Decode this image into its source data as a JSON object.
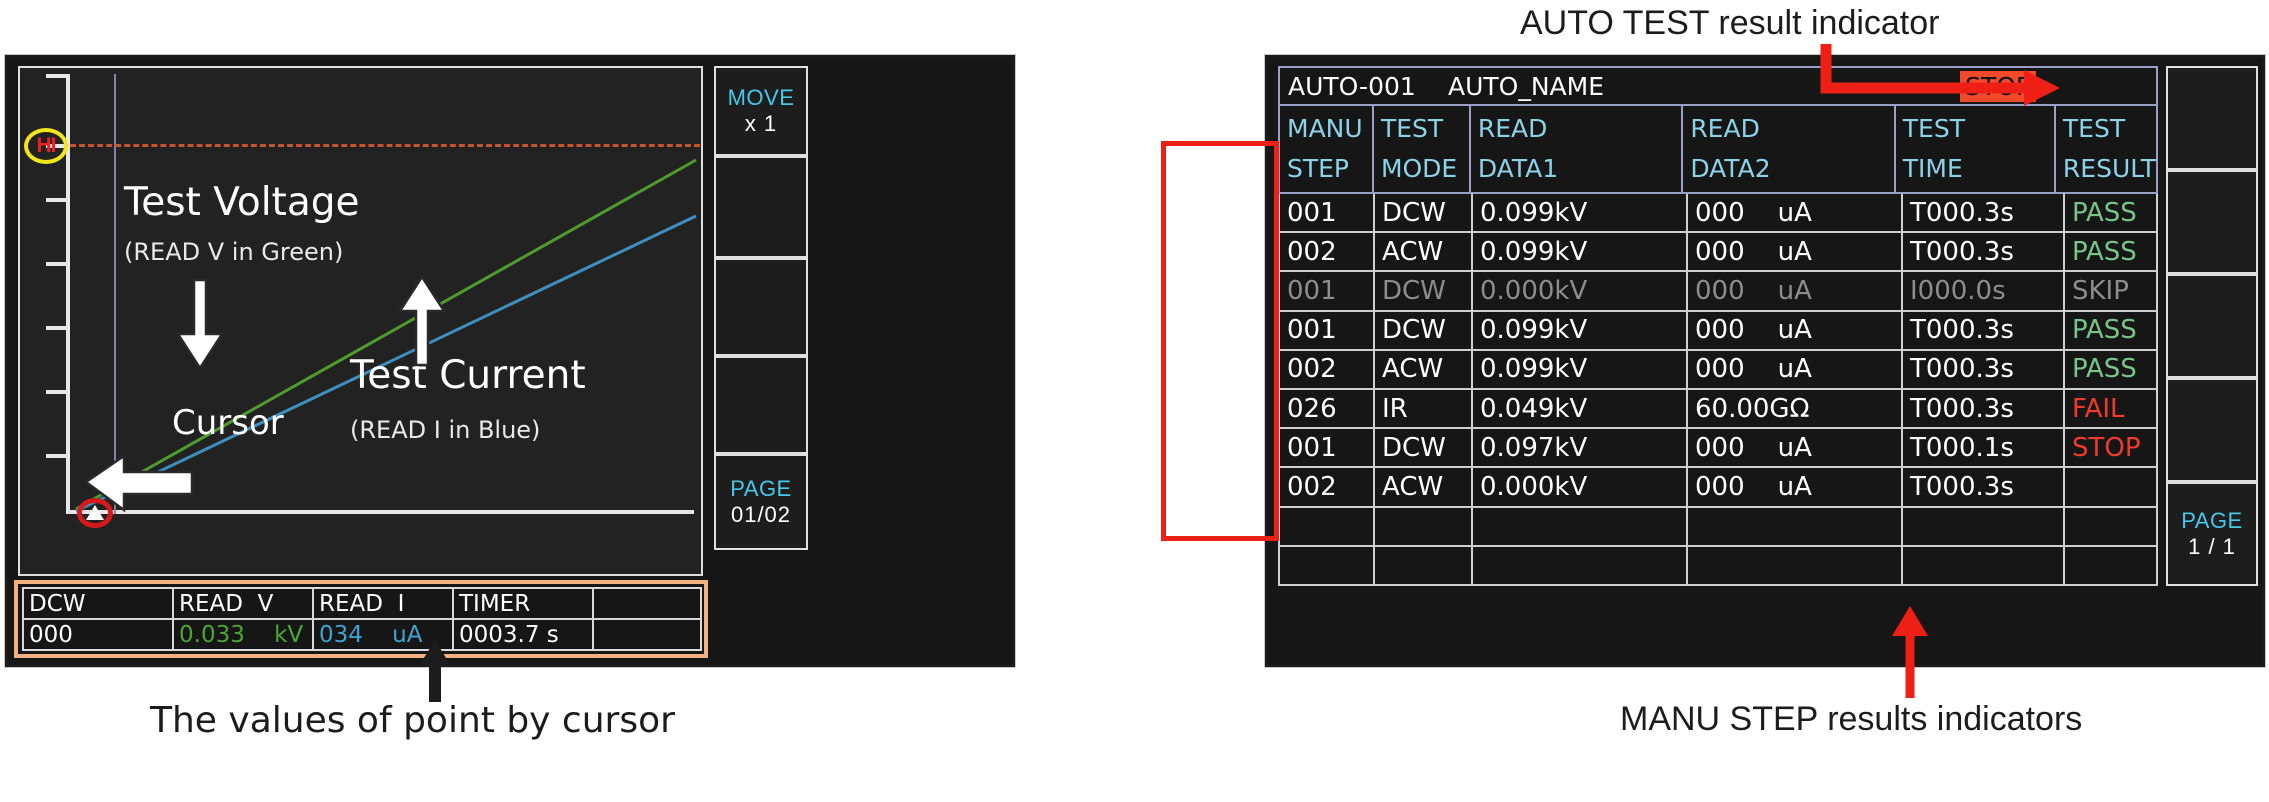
{
  "left_screen": {
    "plot": {
      "hi_badge": "HI",
      "label_voltage": "Test Voltage",
      "label_voltage_sub": "(READ V in Green)",
      "label_current": "Test Current",
      "label_current_sub": "(READ I in Blue)",
      "label_cursor": "Cursor",
      "voltage_color": "#4f9b2e",
      "current_color": "#3e8fc0",
      "cursor_line_color": "#8a7fa8",
      "hi_line_color": "#c4552f"
    },
    "readout": {
      "headers": [
        "DCW",
        "READ  V",
        "READ  I",
        "TIMER",
        ""
      ],
      "values": [
        "000",
        "0.033    kV",
        "034    uA",
        "0003.7 s",
        ""
      ]
    },
    "softkeys": [
      {
        "title": "MOVE",
        "sub": "x   1"
      },
      {
        "title": "",
        "sub": ""
      },
      {
        "title": "",
        "sub": ""
      },
      {
        "title": "",
        "sub": ""
      },
      {
        "title": "PAGE",
        "sub": "01/02"
      }
    ],
    "caption": "The values of point by cursor"
  },
  "right_screen": {
    "title_bar": {
      "auto_id": "AUTO-001",
      "auto_name": "AUTO_NAME",
      "status": "STOP",
      "status_bg": "#f04a2a"
    },
    "headers": [
      "MANU\nSTEP",
      "TEST\nMODE",
      "READ\nDATA1",
      "READ\nDATA2",
      "TEST\nTIME",
      "TEST\nRESULT"
    ],
    "rows": [
      {
        "step": "001",
        "mode": "DCW",
        "data1": "0.099kV",
        "data2": "000    uA",
        "time": "T000.3s",
        "result": "PASS",
        "result_class": "r-pass",
        "dim": false
      },
      {
        "step": "002",
        "mode": "ACW",
        "data1": "0.099kV",
        "data2": "000    uA",
        "time": "T000.3s",
        "result": "PASS",
        "result_class": "r-pass",
        "dim": false
      },
      {
        "step": "001",
        "mode": "DCW",
        "data1": "0.000kV",
        "data2": "000    uA",
        "time": "I000.0s",
        "result": "SKIP",
        "result_class": "r-skip",
        "dim": true
      },
      {
        "step": "001",
        "mode": "DCW",
        "data1": "0.099kV",
        "data2": "000    uA",
        "time": "T000.3s",
        "result": "PASS",
        "result_class": "r-pass",
        "dim": false
      },
      {
        "step": "002",
        "mode": "ACW",
        "data1": "0.099kV",
        "data2": "000    uA",
        "time": "T000.3s",
        "result": "PASS",
        "result_class": "r-pass",
        "dim": false
      },
      {
        "step": "026",
        "mode": "IR",
        "data1": "0.049kV",
        "data2": "60.00GΩ",
        "time": "T000.3s",
        "result": "FAIL",
        "result_class": "r-fail",
        "dim": false
      },
      {
        "step": "001",
        "mode": "DCW",
        "data1": "0.097kV",
        "data2": "000    uA",
        "time": "T000.1s",
        "result": "STOP",
        "result_class": "r-stop",
        "dim": false
      },
      {
        "step": "002",
        "mode": "ACW",
        "data1": "0.000kV",
        "data2": "000    uA",
        "time": "T000.3s",
        "result": "",
        "result_class": "",
        "dim": false
      },
      {
        "step": "",
        "mode": "",
        "data1": "",
        "data2": "",
        "time": "",
        "result": "",
        "result_class": "",
        "dim": false
      },
      {
        "step": "",
        "mode": "",
        "data1": "",
        "data2": "",
        "time": "",
        "result": "",
        "result_class": "",
        "dim": false
      }
    ],
    "softkeys": [
      {
        "title": "",
        "sub": ""
      },
      {
        "title": "",
        "sub": ""
      },
      {
        "title": "",
        "sub": ""
      },
      {
        "title": "",
        "sub": ""
      },
      {
        "title": "PAGE",
        "sub": "1 / 1"
      }
    ],
    "caption_top": "AUTO TEST result indicator",
    "caption_bottom": "MANU STEP results indicators",
    "highlight_color": "#ee1f15"
  }
}
